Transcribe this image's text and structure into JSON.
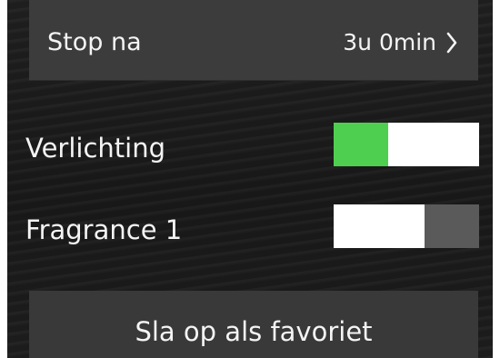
{
  "stop_timer": {
    "label": "Stop na",
    "value": "3u 0min",
    "icon": "chevron-right-icon"
  },
  "toggles": [
    {
      "label": "Verlichting",
      "state": "on",
      "color_on": "#4fcf4f"
    },
    {
      "label": "Fragrance 1",
      "state": "off",
      "color_off": "#5a5a5a"
    }
  ],
  "favorite_button": {
    "label": "Sla op als favoriet"
  }
}
